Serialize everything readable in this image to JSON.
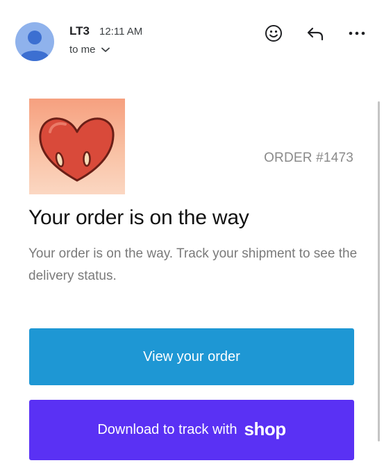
{
  "header": {
    "sender": "LT3",
    "time": "12:11 AM",
    "recipient": "to me",
    "icons": [
      "avatar-person-icon",
      "emoji-icon",
      "reply-icon",
      "more-options-icon"
    ]
  },
  "email": {
    "order_number": "ORDER #1473",
    "title": "Your order is on the way",
    "body": "Your order is on the way. Track your shipment to see the delivery status.",
    "view_order_button": "View your order",
    "download_button_text": "Download to track with",
    "shop_logo": "shop"
  },
  "colors": {
    "view_button": "#1e97d4",
    "shop_button": "#5a31f4",
    "avatar_bg": "#8fb2ec",
    "product_bg": "#f6a07f"
  }
}
